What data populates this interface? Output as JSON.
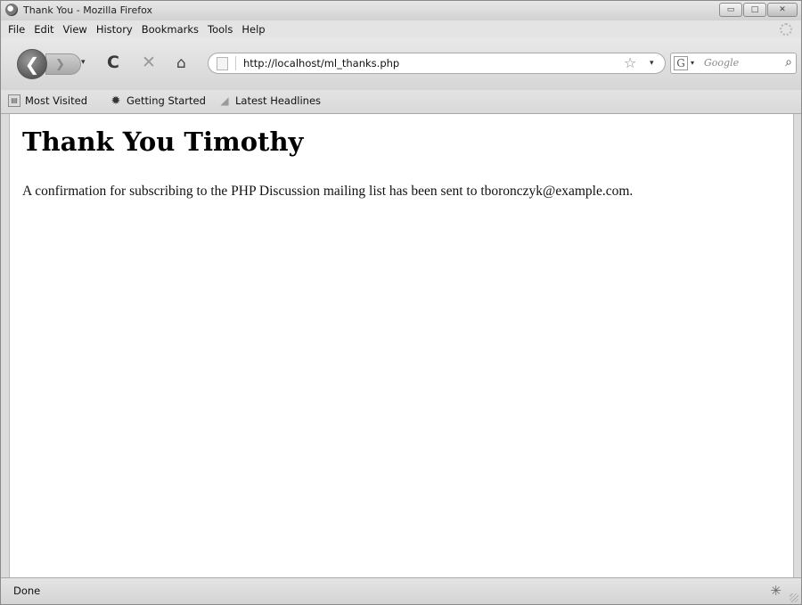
{
  "window": {
    "title": "Thank You - Mozilla Firefox",
    "minimize_label": "▭",
    "maximize_label": "□",
    "close_label": "✕"
  },
  "menu": {
    "items": [
      "File",
      "Edit",
      "View",
      "History",
      "Bookmarks",
      "Tools",
      "Help"
    ]
  },
  "navigation": {
    "back_glyph": "❮",
    "forward_glyph": "❯",
    "dropdown_glyph": "▾",
    "reload_glyph": "C",
    "stop_glyph": "✕",
    "home_glyph": "⌂",
    "url": "http://localhost/ml_thanks.php",
    "bookmark_star_glyph": "☆"
  },
  "search": {
    "engine_glyph": "G",
    "placeholder": "Google",
    "search_glyph": "⌕"
  },
  "bookmarks_toolbar": {
    "items": [
      {
        "label": "Most Visited",
        "icon": "most-visited-icon"
      },
      {
        "label": "Getting Started",
        "icon": "firefox-icon"
      },
      {
        "label": "Latest Headlines",
        "icon": "rss-icon"
      }
    ]
  },
  "page": {
    "heading": "Thank You Timothy",
    "message": "A confirmation for subscribing to the PHP Discussion mailing list has been sent to tboronczyk@example.com."
  },
  "status": {
    "text": "Done"
  }
}
